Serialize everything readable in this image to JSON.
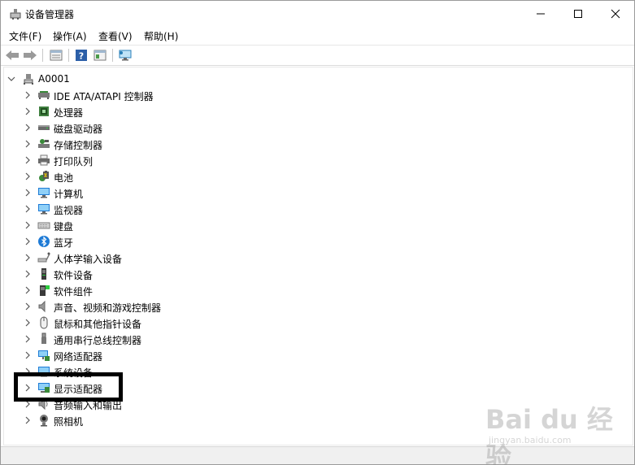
{
  "window": {
    "title": "设备管理器",
    "minimize_icon": "minimize-icon",
    "maximize_icon": "maximize-icon",
    "close_icon": "close-icon"
  },
  "menu": {
    "file": "文件(F)",
    "action": "操作(A)",
    "view": "查看(V)",
    "help": "帮助(H)"
  },
  "toolbar": {
    "icons": [
      "back-arrow-icon",
      "forward-arrow-icon",
      "properties-icon",
      "help-icon",
      "details-view-icon",
      "monitor-scan-icon"
    ]
  },
  "tree": {
    "root": {
      "label": "A0001",
      "icon": "computer-root-icon",
      "expanded": true
    },
    "items": [
      {
        "label": "IDE ATA/ATAPI 控制器",
        "icon": "ide-controller-icon"
      },
      {
        "label": "处理器",
        "icon": "processor-icon"
      },
      {
        "label": "磁盘驱动器",
        "icon": "disk-drive-icon"
      },
      {
        "label": "存储控制器",
        "icon": "storage-controller-icon"
      },
      {
        "label": "打印队列",
        "icon": "printer-icon"
      },
      {
        "label": "电池",
        "icon": "battery-icon"
      },
      {
        "label": "计算机",
        "icon": "computer-icon"
      },
      {
        "label": "监视器",
        "icon": "monitor-icon"
      },
      {
        "label": "键盘",
        "icon": "keyboard-icon"
      },
      {
        "label": "蓝牙",
        "icon": "bluetooth-icon"
      },
      {
        "label": "人体学输入设备",
        "icon": "hid-icon"
      },
      {
        "label": "软件设备",
        "icon": "software-device-icon"
      },
      {
        "label": "软件组件",
        "icon": "software-component-icon"
      },
      {
        "label": "声音、视频和游戏控制器",
        "icon": "sound-icon"
      },
      {
        "label": "鼠标和其他指针设备",
        "icon": "mouse-icon"
      },
      {
        "label": "通用串行总线控制器",
        "icon": "usb-icon"
      },
      {
        "label": "网络适配器",
        "icon": "network-adapter-icon"
      },
      {
        "label": "系统设备",
        "icon": "system-device-icon"
      },
      {
        "label": "显示适配器",
        "icon": "display-adapter-icon"
      },
      {
        "label": "音频输入和输出",
        "icon": "audio-io-icon"
      },
      {
        "label": "照相机",
        "icon": "camera-icon"
      }
    ]
  },
  "watermark": {
    "text": "Bai du 经验",
    "sub": "jingyan.baidu.com"
  },
  "colors": {
    "accent": "#1e7bd6",
    "highlight_border": "#000000"
  }
}
